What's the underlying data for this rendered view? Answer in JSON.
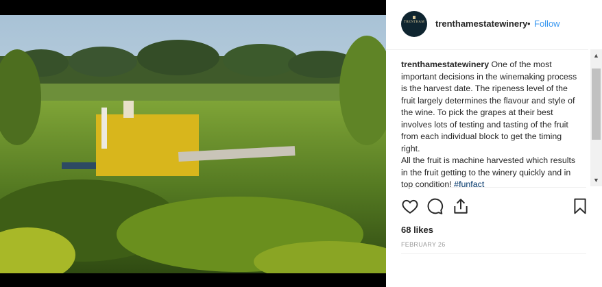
{
  "post": {
    "username": "trenthamestatewinery",
    "follow_label": "Follow",
    "avatar_text": "TRENTHAM",
    "caption_p1": "One of the most important decisions in the winemaking process is the harvest date. The ripeness level of the fruit largely determines the flavour and style of the wine. To pick the grapes at their best involves lots of testing and tasting of the fruit from each individual block to get the timing right.",
    "caption_p2": "All the fruit is machine harvested which results in the fruit getting to the winery quickly and in top condition!",
    "hashtag": "#funfact",
    "likes": "68 likes",
    "date": "FEBRUARY 26"
  },
  "icons": [
    "heart-icon",
    "comment-icon",
    "share-icon",
    "bookmark-icon"
  ],
  "colors": {
    "link": "#3897f0",
    "text": "#262626",
    "hashtag": "#003569",
    "muted": "#999999"
  }
}
